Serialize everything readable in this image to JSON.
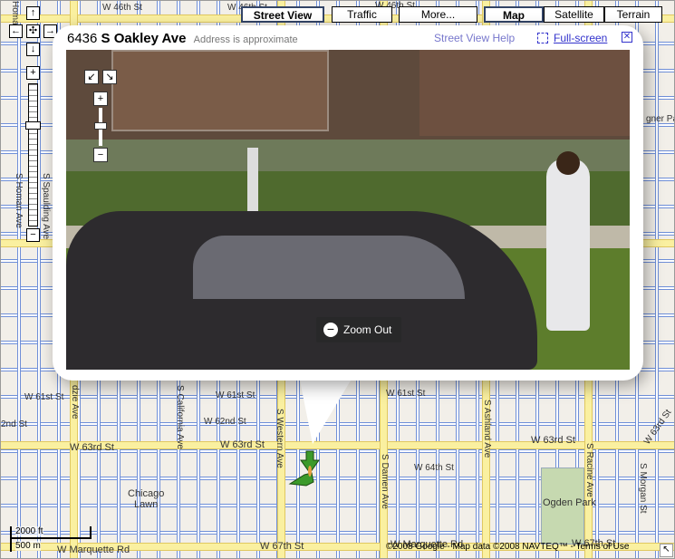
{
  "map_types": {
    "street_view": "Street View",
    "traffic": "Traffic",
    "more": "More...",
    "map": "Map",
    "satellite": "Satellite",
    "terrain": "Terrain"
  },
  "nav": {
    "up": "↑",
    "left": "←",
    "center": "✣",
    "right": "→",
    "down": "↓",
    "zoom_in": "+",
    "zoom_out": "−"
  },
  "bubble": {
    "house_number": "6436",
    "street": "S Oakley Ave",
    "approx": "Address is approximate",
    "help": "Street View Help",
    "fullscreen": "Full-screen",
    "close": "✕"
  },
  "photo": {
    "zoom_out_label": "Zoom Out",
    "zoom_out_icon": "−",
    "plus": "+",
    "minus": "−",
    "expand": "↙",
    "shrink": "↘"
  },
  "map_labels": {
    "w46": "W 46th St",
    "w46b": "W 46th St",
    "w46c": "W 46th St",
    "w61": "W 61st St",
    "w61b": "W 61st St",
    "w61c": "W 61st St",
    "w62": "W 62nd St",
    "w62b": "2nd St",
    "w63a": "W 63rd St",
    "w63b": "W 63rd St",
    "w63c": "W 63rd St",
    "w63d": "W 63rd St",
    "w64": "W 64th St",
    "w67a": "W 67th St",
    "w67b": "W 67th St",
    "marq": "W Marquette Rd",
    "marq2": "W Marquette Rd",
    "western": "S Western Ave",
    "damen": "S Damen Ave",
    "ashland": "S Ashland Ave",
    "racine": "S Racine Ave",
    "morgan": "S Morgan St",
    "california": "S California Ave",
    "kedzie": "dzie Ave",
    "homan": "S Homan Ave",
    "homan2": "Homan",
    "spaulding": "S Spaulding Ave",
    "lawn": "Chicago\nLawn",
    "ogden": "Ogden Park",
    "park": "gner Park"
  },
  "scale": {
    "ft": "2000 ft",
    "m": "500 m"
  },
  "copyright": "©2008 Google - Map data ©2008 NAVTEQ™ - Terms of Use",
  "colors": {
    "road": "#faf0a0",
    "block_outline": "#6f8fd8",
    "link": "#3333cc",
    "marker": "#3c9a2a"
  }
}
